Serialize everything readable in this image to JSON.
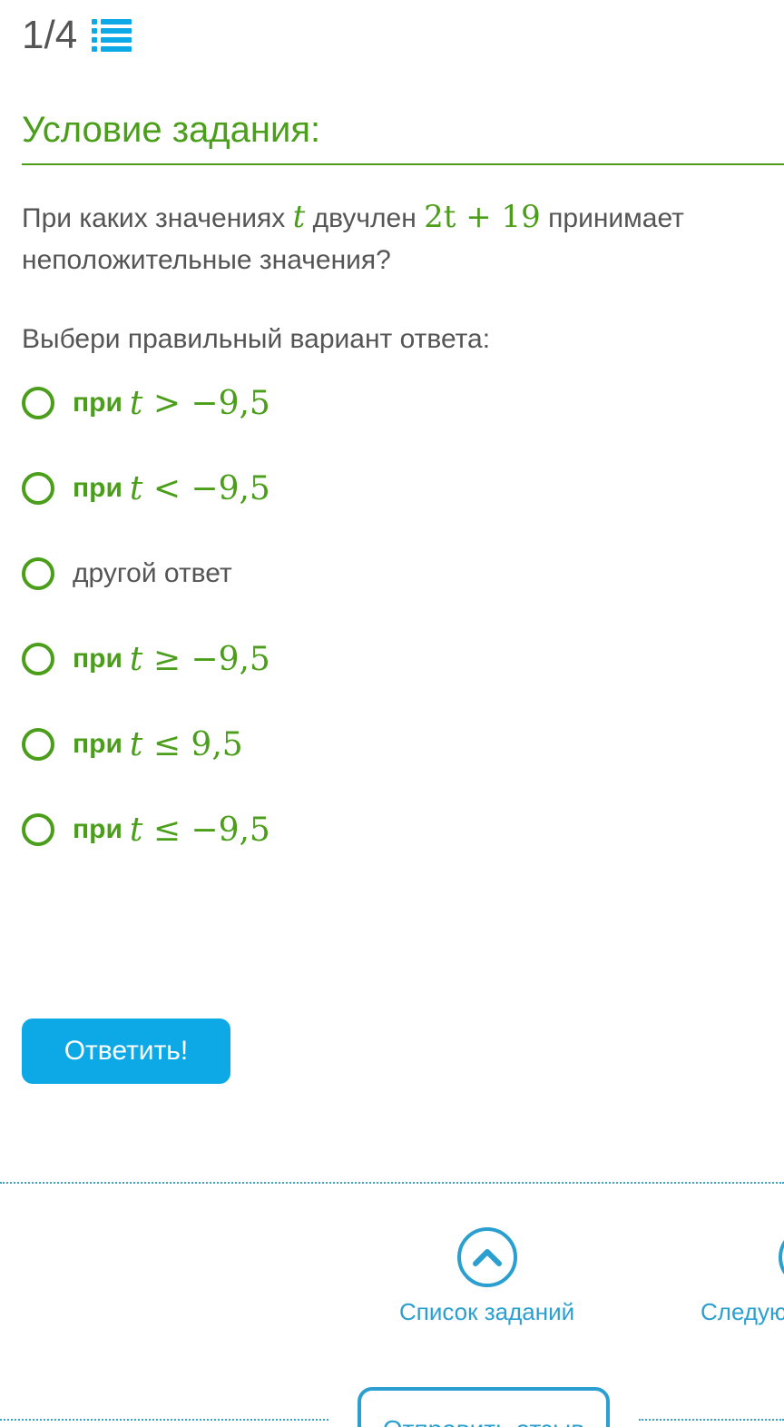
{
  "progress": {
    "counter": "1/4",
    "icon": "list-icon"
  },
  "task": {
    "heading": "Условие задания:",
    "question": {
      "part1": "При каких значениях",
      "var": "t",
      "part2": "двучлен",
      "expr": "2t + 19",
      "part3": "принимает неположительные значения?"
    },
    "instruction": "Выбери правильный вариант ответа:"
  },
  "options": [
    {
      "prefix": "при",
      "var": "t",
      "rel": "> −9,5"
    },
    {
      "prefix": "при",
      "var": "t",
      "rel": "< −9,5"
    },
    {
      "text": "другой ответ"
    },
    {
      "prefix": "при",
      "var": "t",
      "rel": "≥ −9,5"
    },
    {
      "prefix": "при",
      "var": "t",
      "rel": "≤ 9,5"
    },
    {
      "prefix": "при",
      "var": "t",
      "rel": "≤ −9,5"
    }
  ],
  "actions": {
    "answer_label": "Ответить!"
  },
  "footer": {
    "tasks_label": "Список заданий",
    "next_label": "Следую",
    "feedback_label": "Отправить отзыв"
  },
  "colors": {
    "accent_green": "#4a9e1a",
    "button_blue": "#0da9e6",
    "link_blue": "#2a9fd0"
  }
}
